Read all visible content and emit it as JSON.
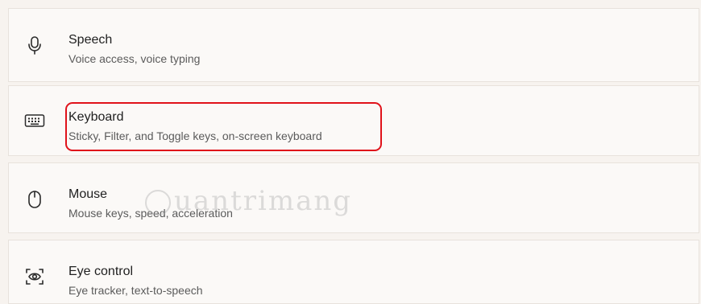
{
  "items": [
    {
      "title": "Speech",
      "subtitle": "Voice access, voice typing",
      "icon": "microphone-icon"
    },
    {
      "title": "Keyboard",
      "subtitle": "Sticky, Filter, and Toggle keys, on-screen keyboard",
      "icon": "keyboard-icon"
    },
    {
      "title": "Mouse",
      "subtitle": "Mouse keys, speed, acceleration",
      "icon": "mouse-icon"
    },
    {
      "title": "Eye control",
      "subtitle": "Eye tracker, text-to-speech",
      "icon": "eye-control-icon"
    }
  ],
  "watermark": {
    "text": "uantrimang"
  },
  "colors": {
    "background": "#f7f3ef",
    "card": "#fbf9f7",
    "highlight": "#e0121a"
  }
}
